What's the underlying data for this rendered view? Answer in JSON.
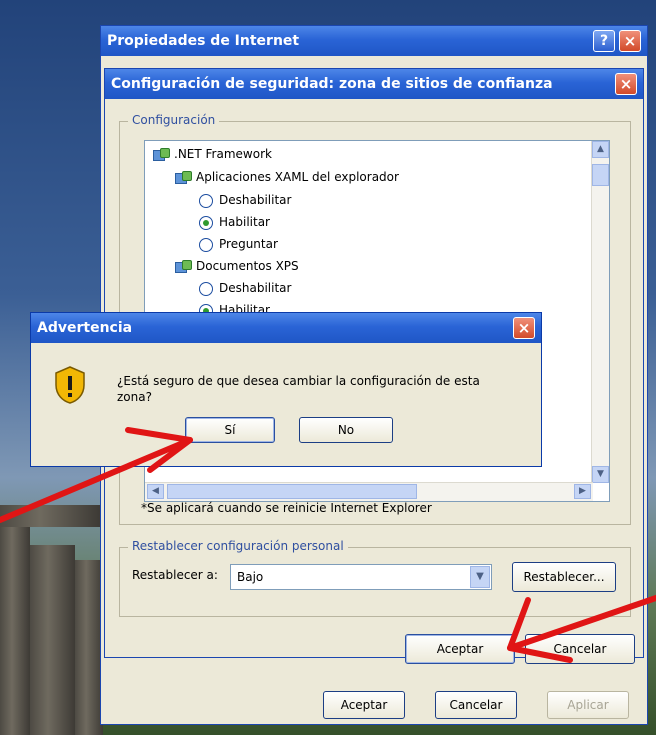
{
  "outer_window": {
    "title": "Propiedades de Internet",
    "help_glyph": "?",
    "close_glyph": "×",
    "buttons": {
      "accept": "Aceptar",
      "cancel": "Cancelar",
      "apply": "Aplicar"
    }
  },
  "security_dialog": {
    "title": "Configuración de seguridad: zona de sitios de confianza",
    "close_glyph": "×",
    "group_label": "Configuración",
    "tree": [
      {
        "type": "category",
        "label": ".NET Framework"
      },
      {
        "type": "subcategory",
        "label": "Aplicaciones XAML del explorador"
      },
      {
        "type": "option",
        "label": "Deshabilitar",
        "selected": false
      },
      {
        "type": "option",
        "label": "Habilitar",
        "selected": true
      },
      {
        "type": "option",
        "label": "Preguntar",
        "selected": false
      },
      {
        "type": "subcategory",
        "label": "Documentos XPS"
      },
      {
        "type": "option",
        "label": "Deshabilitar",
        "selected": false
      },
      {
        "type": "option",
        "label": "Habilitar",
        "selected": true
      }
    ],
    "footnote": "*Se aplicará cuando se reinicie Internet Explorer",
    "reset_group_label": "Restablecer configuración personal",
    "reset_to_label": "Restablecer a:",
    "reset_level_value": "Bajo",
    "reset_button": "Restablecer...",
    "accept_button": "Aceptar",
    "cancel_button": "Cancelar"
  },
  "warning_dialog": {
    "title": "Advertencia",
    "close_glyph": "×",
    "message": "¿Está seguro de que desea cambiar la configuración de esta zona?",
    "icon": "warning-shield-icon",
    "yes_button": "Sí",
    "no_button": "No"
  },
  "colors": {
    "title_bar": "#2a64d6",
    "dialog_face": "#ece9d8",
    "close_button": "#d24a2a",
    "annotation_arrow": "#e01515"
  }
}
